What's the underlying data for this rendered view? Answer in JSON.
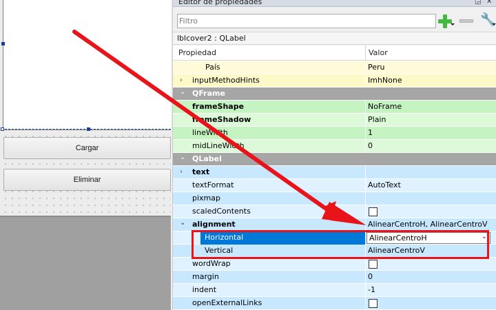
{
  "designer": {
    "buttons": [
      "Cargar",
      "Eliminar"
    ]
  },
  "property_editor": {
    "title": "Editor de propiedades",
    "title_buttons": [
      "◲",
      "✕"
    ],
    "filter_placeholder": "Filtro",
    "object_label": "lblcover2 : QLabel",
    "headers": {
      "property": "Propiedad",
      "value": "Valor"
    },
    "rows": [
      {
        "name": "País",
        "value": "Peru"
      },
      {
        "name": "inputMethodHints",
        "value": "ImhNone"
      },
      {
        "name": "QFrame",
        "value": ""
      },
      {
        "name": "frameShape",
        "value": "NoFrame"
      },
      {
        "name": "frameShadow",
        "value": "Plain"
      },
      {
        "name": "lineWidth",
        "value": "1"
      },
      {
        "name": "midLineWidth",
        "value": "0"
      },
      {
        "name": "QLabel",
        "value": ""
      },
      {
        "name": "text",
        "value": ""
      },
      {
        "name": "textFormat",
        "value": "AutoText"
      },
      {
        "name": "pixmap",
        "value": ""
      },
      {
        "name": "scaledContents",
        "value": ""
      },
      {
        "name": "alignment",
        "value": "AlinearCentroH, AlinearCentroV"
      },
      {
        "name": "Horizontal",
        "value": "AlinearCentroH"
      },
      {
        "name": "Vertical",
        "value": "AlinearCentroV"
      },
      {
        "name": "wordWrap",
        "value": ""
      },
      {
        "name": "margin",
        "value": "0"
      },
      {
        "name": "indent",
        "value": "-1"
      },
      {
        "name": "openExternalLinks",
        "value": ""
      }
    ]
  },
  "colors": {
    "annotation_red": "#e8141a",
    "selection_blue": "#0078d7",
    "category_gray": "#a6a6a6"
  }
}
